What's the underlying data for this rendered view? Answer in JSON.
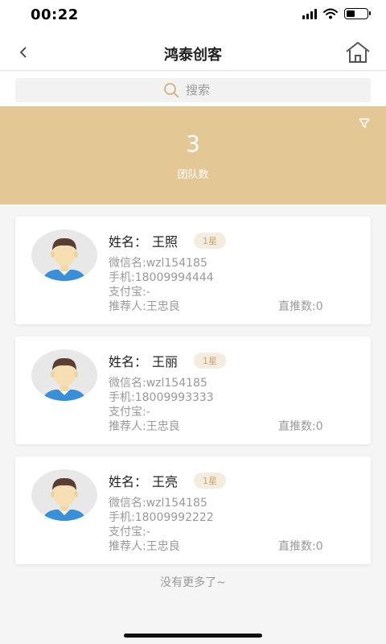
{
  "status_bar": {
    "time": "00:22"
  },
  "nav": {
    "title": "鸿泰创客"
  },
  "search": {
    "placeholder": "搜索"
  },
  "banner": {
    "count": "3",
    "label": "团队数"
  },
  "members": [
    {
      "name_label": "姓名：",
      "name": "王照",
      "stars": "1星",
      "wechat": "微信名:wzl154185",
      "phone": "手机:18009994444",
      "alipay": "支付宝:-",
      "referrer": "推荐人:王忠良",
      "direct": "直推数:0"
    },
    {
      "name_label": "姓名：",
      "name": "王丽",
      "stars": "1星",
      "wechat": "微信名:wzl154185",
      "phone": "手机:18009993333",
      "alipay": "支付宝:-",
      "referrer": "推荐人:王忠良",
      "direct": "直推数:0"
    },
    {
      "name_label": "姓名：",
      "name": "王亮",
      "stars": "1星",
      "wechat": "微信名:wzl154185",
      "phone": "手机:18009992222",
      "alipay": "支付宝:-",
      "referrer": "推荐人:王忠良",
      "direct": "直推数:0"
    }
  ],
  "footer": {
    "no_more": "没有更多了~"
  },
  "colors": {
    "accent": "#e3c795",
    "badge_text": "#c9a56c",
    "badge_bg": "#f5ece0"
  }
}
